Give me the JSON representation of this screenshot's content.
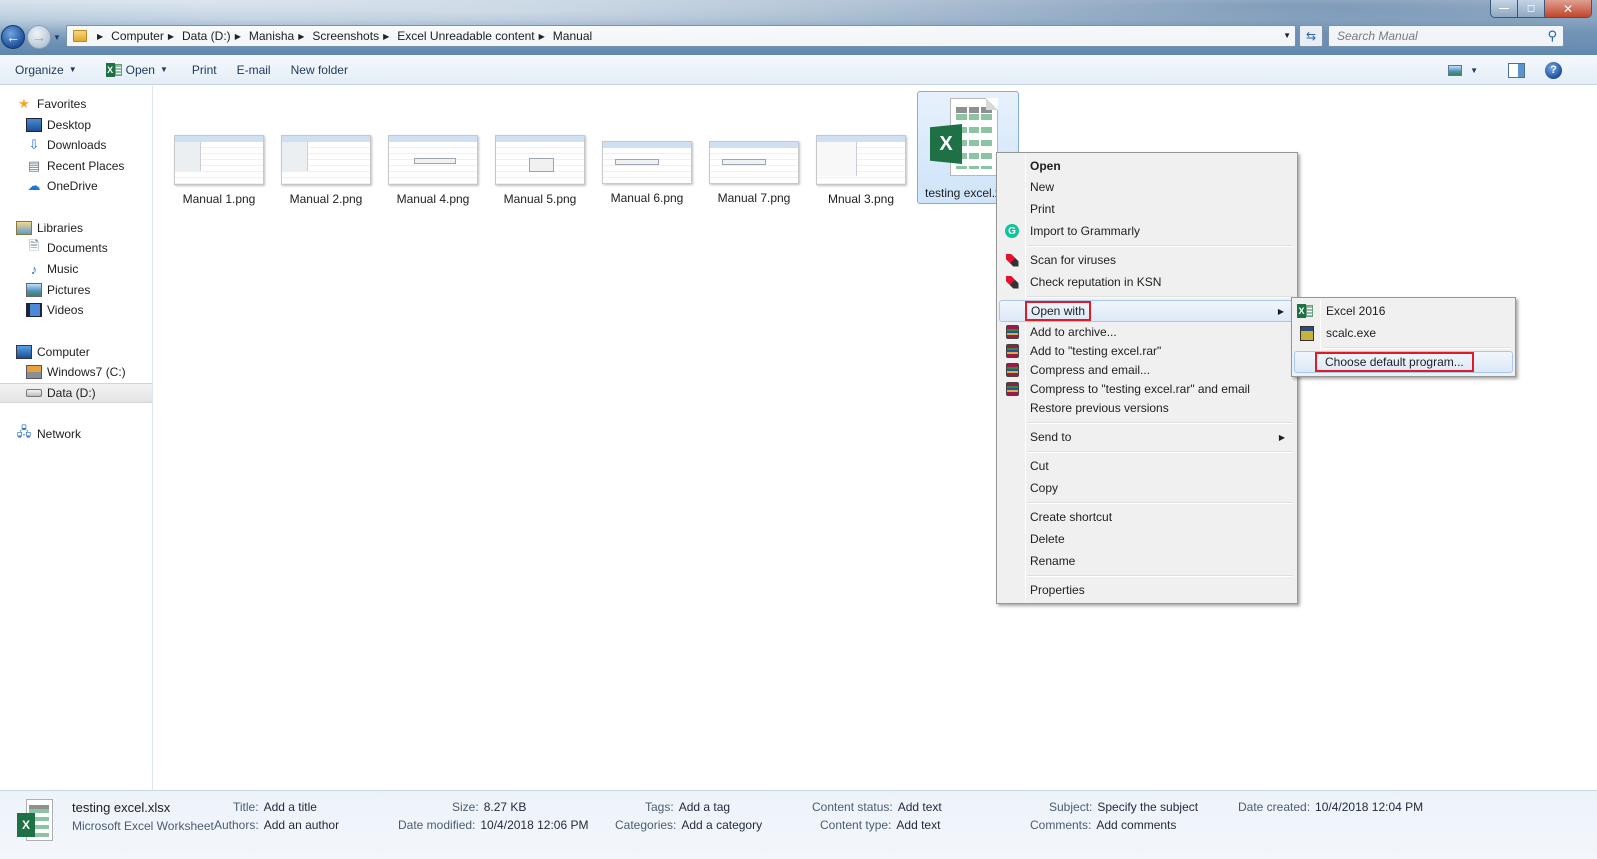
{
  "window": {
    "buttons": {
      "minimize": "—",
      "maximize": "◻",
      "close": "✕"
    }
  },
  "address_bar": {
    "breadcrumbs": [
      "Computer",
      "Data (D:)",
      "Manisha",
      "Screenshots",
      "Excel Unreadable content",
      "Manual"
    ]
  },
  "search": {
    "placeholder": "Search Manual"
  },
  "toolbar": {
    "organize_label": "Organize",
    "open_label": "Open",
    "print_label": "Print",
    "email_label": "E-mail",
    "new_folder_label": "New folder"
  },
  "navigation": {
    "groups": [
      {
        "label": "Favorites",
        "icon": "star-icon",
        "items": [
          {
            "label": "Desktop",
            "icon": "desktop-icon"
          },
          {
            "label": "Downloads",
            "icon": "downloads-icon"
          },
          {
            "label": "Recent Places",
            "icon": "recent-places-icon"
          },
          {
            "label": "OneDrive",
            "icon": "cloud-icon"
          }
        ]
      },
      {
        "label": "Libraries",
        "icon": "libraries-icon",
        "items": [
          {
            "label": "Documents",
            "icon": "document-icon"
          },
          {
            "label": "Music",
            "icon": "music-icon"
          },
          {
            "label": "Pictures",
            "icon": "pictures-icon"
          },
          {
            "label": "Videos",
            "icon": "videos-icon"
          }
        ]
      },
      {
        "label": "Computer",
        "icon": "computer-icon",
        "items": [
          {
            "label": "Windows7 (C:)",
            "icon": "drive-icon"
          },
          {
            "label": "Data (D:)",
            "icon": "drive-icon",
            "selected": true
          }
        ]
      },
      {
        "label": "Network",
        "icon": "network-icon",
        "items": []
      }
    ]
  },
  "files": [
    {
      "name": "Manual 1.png",
      "kind": "image"
    },
    {
      "name": "Manual 2.png",
      "kind": "image"
    },
    {
      "name": "Manual 4.png",
      "kind": "image"
    },
    {
      "name": "Manual 5.png",
      "kind": "image"
    },
    {
      "name": "Manual 6.png",
      "kind": "image"
    },
    {
      "name": "Manual 7.png",
      "kind": "image"
    },
    {
      "name": "Mnual 3.png",
      "kind": "image"
    },
    {
      "name": "testing excel.xlsx",
      "display_name": "testing excel.x",
      "kind": "excel",
      "selected": true
    }
  ],
  "context_menu": {
    "items": [
      {
        "label": "Open",
        "bold": true
      },
      {
        "label": "New"
      },
      {
        "label": "Print"
      },
      {
        "label": "Import to Grammarly",
        "icon": "grammarly-icon"
      },
      {
        "label": "Scan for viruses",
        "icon": "kaspersky-icon"
      },
      {
        "label": "Check reputation in KSN",
        "icon": "kaspersky-icon"
      },
      {
        "label": "Open with",
        "submenu": true,
        "highlighted": true
      },
      {
        "label": "Add to archive...",
        "icon": "winrar-icon"
      },
      {
        "label": "Add to \"testing excel.rar\"",
        "icon": "winrar-icon"
      },
      {
        "label": "Compress and email...",
        "icon": "winrar-icon"
      },
      {
        "label": "Compress to \"testing excel.rar\" and email",
        "icon": "winrar-icon"
      },
      {
        "label": "Restore previous versions"
      },
      {
        "label": "Send to",
        "submenu": true
      },
      {
        "label": "Cut"
      },
      {
        "label": "Copy"
      },
      {
        "label": "Create shortcut"
      },
      {
        "label": "Delete"
      },
      {
        "label": "Rename"
      },
      {
        "label": "Properties"
      }
    ],
    "submenu_open_with": [
      {
        "label": "Excel 2016",
        "icon": "excel-icon"
      },
      {
        "label": "scalc.exe",
        "icon": "calc-icon"
      },
      {
        "label": "Choose default program...",
        "highlighted": true
      }
    ]
  },
  "details": {
    "file_name": "testing excel.xlsx",
    "file_type": "Microsoft Excel Worksheet",
    "fields": [
      {
        "label": "Title:",
        "value": "Add a title"
      },
      {
        "label": "Authors:",
        "value": "Add an author"
      },
      {
        "label": "Size:",
        "value": "8.27 KB"
      },
      {
        "label": "Date modified:",
        "value": "10/4/2018 12:06 PM"
      },
      {
        "label": "Tags:",
        "value": "Add a tag"
      },
      {
        "label": "Categories:",
        "value": "Add a category"
      },
      {
        "label": "Content status:",
        "value": "Add text"
      },
      {
        "label": "Content type:",
        "value": "Add text"
      },
      {
        "label": "Subject:",
        "value": "Specify the subject"
      },
      {
        "label": "Comments:",
        "value": "Add comments"
      },
      {
        "label": "Date created:",
        "value": "10/4/2018 12:04 PM"
      }
    ]
  },
  "colors": {
    "excel_green": "#1d7145",
    "highlight_red": "#e01b24",
    "selection_blue": "#cfe4fa"
  }
}
